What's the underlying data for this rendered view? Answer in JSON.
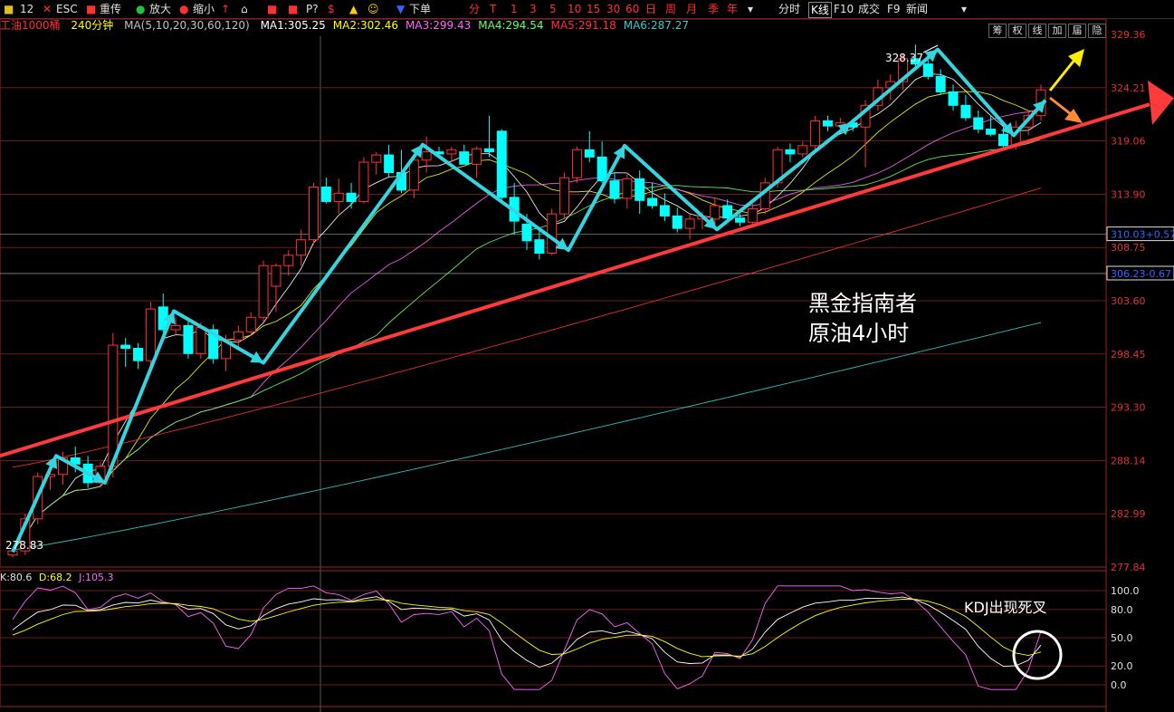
{
  "toolbar": {
    "items": [
      "12",
      "ESC",
      "重传",
      "放大",
      "缩小",
      "P?",
      "下单",
      "分",
      "T",
      "1",
      "3",
      "5",
      "10",
      "15",
      "30",
      "60",
      "日",
      "周",
      "月",
      "季",
      "年",
      "分时",
      "K线",
      "F10",
      "成交",
      "F9",
      "新闻"
    ]
  },
  "header": {
    "symbol": "工油1000桶",
    "period": "240分钟",
    "ma_label": "MA(5,10,20,30,60,120)",
    "ma": [
      {
        "text": "MA1:305.25",
        "color": "#ffffff"
      },
      {
        "text": "MA2:302.46",
        "color": "#ffff00"
      },
      {
        "text": "MA3:299.43",
        "color": "#ff66ff"
      },
      {
        "text": "MA4:294.54",
        "color": "#66ff66"
      },
      {
        "text": "MA5:291.18",
        "color": "#ff3333"
      },
      {
        "text": "MA6:287.27",
        "color": "#33cccc"
      }
    ],
    "right_buttons": [
      "筹",
      "权",
      "线",
      "加",
      "届",
      "隐"
    ]
  },
  "price_axis": {
    "ticks": [
      "329.36",
      "324.21",
      "319.06",
      "313.90",
      "308.75",
      "303.60",
      "298.45",
      "293.30",
      "288.14",
      "282.99",
      "277.84"
    ],
    "boxed": [
      {
        "text": "310.03+0.57",
        "color": "#3366ff"
      },
      {
        "text": "306.23-0.67",
        "color": "#3366ff"
      }
    ]
  },
  "annotations": {
    "high": "328.37",
    "low": "278.83",
    "title_line1": "黑金指南者",
    "title_line2": "原油4小时",
    "kdj_note": "KDJ出现死叉"
  },
  "kdj": {
    "k_label": "K:80.6",
    "d_label": "D:68.2",
    "j_label": "J:105.3",
    "ticks": [
      "100.0",
      "80.0",
      "50.0",
      "20.0",
      "0.0"
    ]
  },
  "colors": {
    "up": "#ff3232",
    "down": "#00ffff",
    "trend": "#ff3a3a",
    "swing": "#33d6e0",
    "arrow_up": "#ffee00",
    "arrow_down": "#ff8c33"
  },
  "chart_data": {
    "type": "candlestick",
    "ylim": [
      277.84,
      329.36
    ],
    "candles": [
      [
        279.0,
        279.6,
        278.8,
        279.4
      ],
      [
        279.4,
        283.0,
        279.0,
        282.5
      ],
      [
        282.5,
        287.0,
        282.0,
        286.6
      ],
      [
        286.6,
        288.2,
        285.3,
        286.8
      ],
      [
        286.8,
        289.0,
        285.8,
        288.4
      ],
      [
        288.4,
        289.5,
        287.0,
        287.8
      ],
      [
        287.8,
        288.6,
        285.5,
        286.0
      ],
      [
        286.0,
        288.0,
        285.5,
        287.6
      ],
      [
        287.6,
        300.5,
        286.5,
        299.3
      ],
      [
        299.3,
        300.0,
        297.2,
        299.0
      ],
      [
        299.0,
        299.5,
        297.0,
        297.8
      ],
      [
        297.8,
        303.5,
        297.0,
        302.8
      ],
      [
        303.0,
        304.3,
        300.5,
        300.8
      ],
      [
        300.8,
        302.0,
        300.2,
        301.2
      ],
      [
        301.2,
        302.0,
        298.0,
        298.5
      ],
      [
        298.5,
        301.5,
        298.0,
        301.0
      ],
      [
        300.8,
        301.3,
        297.5,
        298.0
      ],
      [
        298.0,
        300.3,
        296.8,
        299.8
      ],
      [
        299.8,
        301.2,
        299.0,
        300.6
      ],
      [
        300.6,
        302.5,
        300.2,
        302.0
      ],
      [
        302.0,
        307.5,
        301.5,
        307.0
      ],
      [
        305.0,
        307.2,
        302.5,
        307.0
      ],
      [
        307.0,
        308.5,
        306.0,
        308.0
      ],
      [
        308.0,
        310.5,
        307.0,
        309.5
      ],
      [
        309.5,
        315.0,
        309.0,
        314.6
      ],
      [
        314.6,
        315.5,
        313.0,
        313.2
      ],
      [
        313.2,
        315.4,
        312.0,
        314.0
      ],
      [
        314.0,
        315.0,
        312.5,
        313.2
      ],
      [
        313.2,
        317.5,
        313.0,
        317.0
      ],
      [
        317.0,
        318.0,
        315.8,
        317.7
      ],
      [
        317.7,
        318.7,
        315.5,
        316.0
      ],
      [
        316.0,
        318.2,
        314.0,
        314.3
      ],
      [
        314.3,
        317.5,
        313.5,
        317.2
      ],
      [
        317.2,
        319.5,
        316.0,
        318.0
      ],
      [
        318.0,
        318.5,
        317.5,
        317.8
      ],
      [
        317.8,
        318.5,
        317.0,
        318.2
      ],
      [
        318.0,
        318.7,
        316.8,
        316.8
      ],
      [
        316.8,
        318.5,
        315.5,
        318.3
      ],
      [
        318.3,
        321.5,
        317.5,
        318.0
      ],
      [
        320.0,
        320.2,
        313.2,
        313.6
      ],
      [
        313.6,
        315.0,
        310.0,
        311.3
      ],
      [
        311.0,
        312.0,
        308.5,
        309.4
      ],
      [
        309.5,
        310.5,
        307.6,
        308.2
      ],
      [
        308.2,
        312.5,
        308.0,
        312.0
      ],
      [
        312.0,
        316.0,
        311.5,
        315.5
      ],
      [
        315.5,
        318.5,
        315.0,
        318.2
      ],
      [
        318.2,
        320.0,
        317.0,
        317.5
      ],
      [
        317.5,
        319.0,
        315.0,
        315.2
      ],
      [
        315.2,
        316.0,
        313.0,
        313.5
      ],
      [
        313.5,
        316.0,
        312.5,
        315.4
      ],
      [
        315.4,
        316.2,
        312.0,
        313.3
      ],
      [
        313.5,
        315.0,
        312.5,
        312.8
      ],
      [
        312.8,
        314.0,
        311.3,
        311.8
      ],
      [
        311.8,
        312.6,
        310.2,
        310.6
      ],
      [
        310.6,
        312.0,
        309.5,
        311.5
      ],
      [
        311.5,
        312.2,
        310.5,
        311.8
      ],
      [
        311.5,
        313.5,
        310.8,
        312.8
      ],
      [
        312.8,
        313.4,
        311.2,
        311.6
      ],
      [
        311.6,
        312.0,
        310.8,
        311.2
      ],
      [
        311.2,
        313.0,
        310.8,
        312.5
      ],
      [
        312.5,
        315.5,
        312.0,
        315.0
      ],
      [
        315.0,
        318.5,
        314.5,
        318.2
      ],
      [
        318.2,
        318.8,
        317.0,
        317.8
      ],
      [
        317.8,
        319.0,
        317.5,
        318.6
      ],
      [
        318.6,
        321.5,
        318.0,
        321.0
      ],
      [
        321.0,
        321.5,
        320.0,
        320.5
      ],
      [
        320.5,
        321.3,
        319.8,
        320.8
      ],
      [
        320.8,
        321.2,
        320.0,
        320.4
      ],
      [
        320.4,
        323.0,
        316.5,
        322.5
      ],
      [
        322.5,
        325.0,
        322.0,
        324.2
      ],
      [
        324.2,
        325.5,
        323.0,
        324.8
      ],
      [
        324.8,
        327.5,
        324.0,
        327.0
      ],
      [
        327.0,
        328.37,
        326.0,
        326.5
      ],
      [
        326.5,
        327.0,
        325.0,
        325.3
      ],
      [
        325.3,
        326.0,
        323.5,
        323.8
      ],
      [
        323.8,
        324.5,
        322.0,
        322.5
      ],
      [
        322.5,
        323.5,
        321.0,
        321.3
      ],
      [
        321.3,
        322.0,
        319.8,
        320.2
      ],
      [
        320.2,
        321.5,
        319.5,
        319.7
      ],
      [
        319.7,
        320.5,
        318.3,
        318.6
      ],
      [
        318.6,
        321.0,
        318.2,
        320.4
      ],
      [
        320.4,
        322.0,
        319.6,
        321.5
      ],
      [
        321.5,
        324.5,
        321.0,
        324.0
      ]
    ],
    "kdj_range": [
      0,
      100
    ]
  }
}
